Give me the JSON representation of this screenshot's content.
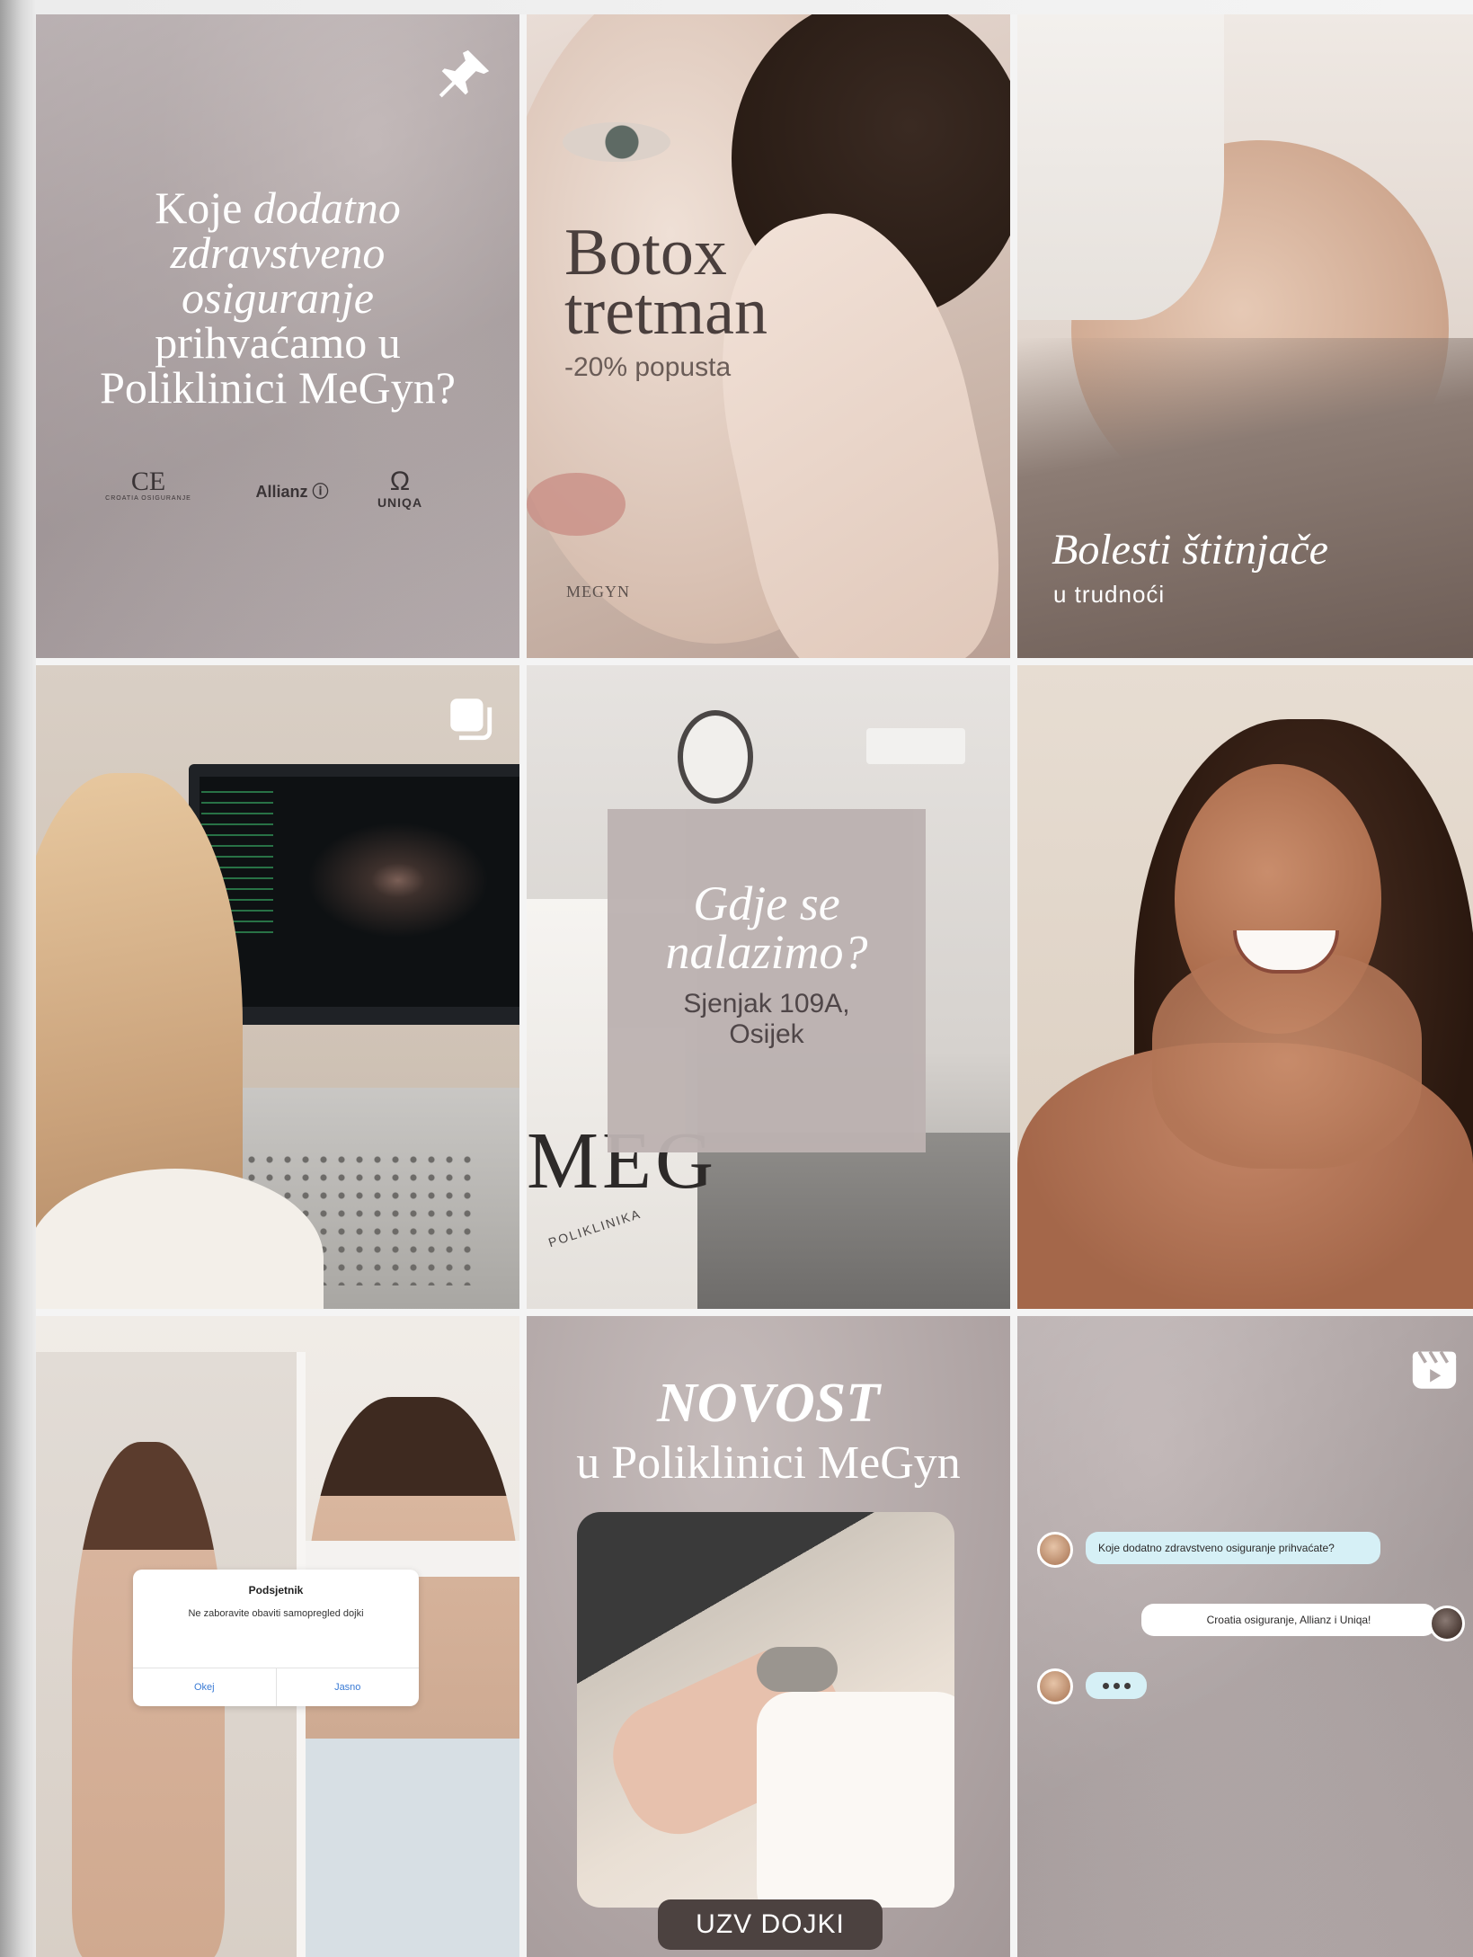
{
  "tile1": {
    "headline_part1": "Koje",
    "headline_italic": "dodatno zdravstveno osiguranje",
    "headline_part2": "prihvaćamo u Poliklinici MeGyn?",
    "logos": [
      {
        "mark": "CE",
        "caption": "CROATIA OSIGURANJE"
      },
      {
        "mark": "Allianz ⓘ",
        "caption": ""
      },
      {
        "mark": "Ω",
        "caption": "UNIQA"
      }
    ],
    "icon": "pin-icon"
  },
  "tile2": {
    "title_line1": "Botox",
    "title_line2": "tretman",
    "subtitle": "-20% popusta",
    "brand": "MEGYN"
  },
  "tile3": {
    "title": "Bolesti štitnjače",
    "subtitle": "u trudnoći"
  },
  "tile4": {
    "icon": "multiple-posts-icon"
  },
  "tile5": {
    "question": "Gdje se nalazimo?",
    "address_line1": "Sjenjak 109A,",
    "address_line2": "Osijek",
    "desk_text": "MEG",
    "desk_sub": "POLIKLINIKA"
  },
  "tile7": {
    "dialog_title": "Podsjetnik",
    "dialog_message": "Ne zaboravite obaviti samopregled dojki",
    "button_ok": "Okej",
    "button_later": "Jasno"
  },
  "tile8": {
    "title": "NOVOST",
    "subtitle": "u Poliklinici MeGyn",
    "pill": "UZV DOJKI"
  },
  "tile9": {
    "icon": "reel-icon",
    "message1": "Koje dodatno zdravstveno osiguranje prihvaćate?",
    "message2": "Croatia osiguranje, Allianz i Uniqa!"
  },
  "colors": {
    "mauve": "#b1a7a8",
    "dark_text": "#4a3f3d",
    "chat_bubble": "#d6f0f6",
    "pill_bg": "#4c4240"
  }
}
